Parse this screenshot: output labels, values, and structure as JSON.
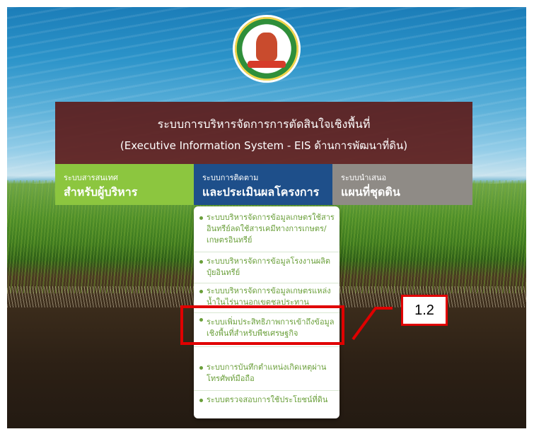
{
  "header": {
    "title_th": "ระบบการบริหารจัดการการตัดสินใจเชิงพื้นที่",
    "title_en": "(Executive Information System - EIS ด้านการพัฒนาที่ดิน)"
  },
  "menu": {
    "tabs": [
      {
        "small": "ระบบสารสนเทศ",
        "big": "สำหรับผู้บริหาร"
      },
      {
        "small": "ระบบการติดตาม",
        "big": "และประเมินผลโครงการ"
      },
      {
        "small": "ระบบนำเสนอ",
        "big": "แผนที่ชุดดิน"
      }
    ]
  },
  "submenu": {
    "items": [
      "ระบบบริหารจัดการข้อมูลเกษตรใช้สารอินทรีย์ลดใช้สารเคมีทางการเกษตร/เกษตรอินทรีย์",
      "ระบบบริหารจัดการข้อมูลโรงงานผลิตปุ๋ยอินทรีย์",
      "ระบบบริหารจัดการข้อมูลเกษตรแหล่งน้ำในไร่นานอกเขตชลประทาน",
      "ระบบเพิ่มประสิทธิภาพการเข้าถึงข้อมูลเชิงพื้นที่สำหรับพืชเศรษฐกิจ",
      "ระบบการบันทึกตำแหน่งเกิดเหตุผ่านโทรศัพท์มือถือ",
      "ระบบตรวจสอบการใช้ประโยชน์ที่ดิน"
    ]
  },
  "annotation": {
    "label": "1.2"
  },
  "colors": {
    "header_bg": "#5c1816",
    "tab_info": "#8cc63f",
    "tab_track": "#1e4f8a",
    "tab_plan": "#8f8b86",
    "highlight": "#e00000",
    "submenu_text": "#6a9f3a"
  }
}
